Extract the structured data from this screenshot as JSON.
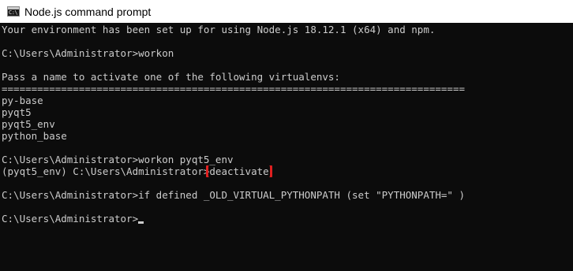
{
  "window": {
    "title": "Node.js command prompt",
    "icon": "console-app-icon",
    "icon_glyph": "C:\\"
  },
  "console": {
    "lines": [
      "Your environment has been set up for using Node.js 18.12.1 (x64) and npm.",
      "",
      "C:\\Users\\Administrator>workon",
      "",
      "Pass a name to activate one of the following virtualenvs:",
      "==============================================================================",
      "py-base",
      "pyqt5",
      "pyqt5_env",
      "python_base",
      "",
      "C:\\Users\\Administrator>workon pyqt5_env",
      "",
      "",
      "C:\\Users\\Administrator>if defined _OLD_VIRTUAL_PYTHONPATH (set \"PYTHONPATH=\" )",
      "",
      ""
    ],
    "venv_prompt": "(pyqt5_env) C:\\Users\\Administrator>",
    "deactivate_cmd": "deactivate",
    "final_prompt": "C:\\Users\\Administrator>"
  },
  "colors": {
    "background": "#0c0c0c",
    "text": "#cccccc",
    "highlight_border": "#e02020"
  }
}
